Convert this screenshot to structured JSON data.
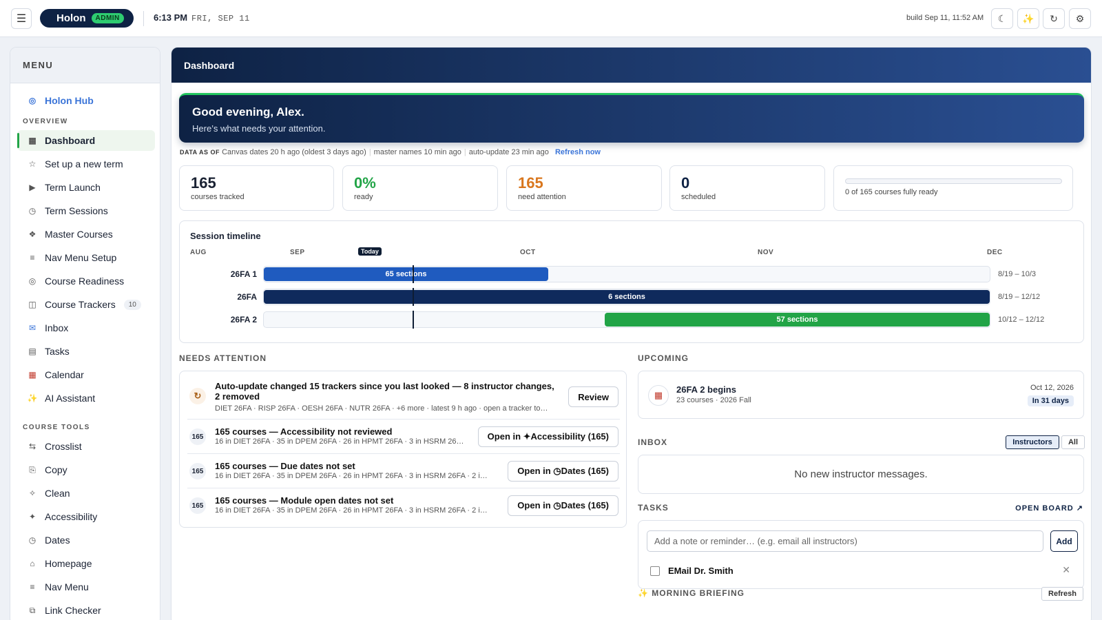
{
  "topbar": {
    "menu_icon": "hamburger-icon",
    "brand": "Holon",
    "brand_badge": "ADMIN",
    "time": "6:13 PM",
    "date": "FRI, SEP 11",
    "build": "build Sep 11, 11:52 AM",
    "buttons": [
      "moon-icon",
      "sparkles-icon",
      "refresh-icon",
      "gear-icon"
    ]
  },
  "sidebar": {
    "title": "MENU",
    "hub": "Holon Hub",
    "overview_label": "OVERVIEW",
    "overview": [
      {
        "label": "Dashboard",
        "icon": "grid-icon"
      },
      {
        "label": "Set up a new term",
        "icon": "star-icon"
      },
      {
        "label": "Term Launch",
        "icon": "play-icon"
      },
      {
        "label": "Term Sessions",
        "icon": "clock-icon"
      },
      {
        "label": "Master Courses",
        "icon": "diamond-icon"
      },
      {
        "label": "Nav Menu Setup",
        "icon": "list-icon"
      },
      {
        "label": "Course Readiness",
        "icon": "target-icon"
      },
      {
        "label": "Course Trackers",
        "icon": "columns-icon",
        "count": "10"
      },
      {
        "label": "Inbox",
        "icon": "mailbox-icon"
      },
      {
        "label": "Tasks",
        "icon": "checklist-icon"
      },
      {
        "label": "Calendar",
        "icon": "calendar-icon"
      },
      {
        "label": "AI Assistant",
        "icon": "sparkles-icon"
      }
    ],
    "tools_label": "COURSE TOOLS",
    "tools": [
      {
        "label": "Crosslist",
        "icon": "arrows-icon"
      },
      {
        "label": "Copy",
        "icon": "copy-icon"
      },
      {
        "label": "Clean",
        "icon": "sparkle-icon"
      },
      {
        "label": "Accessibility",
        "icon": "star4-icon"
      },
      {
        "label": "Dates",
        "icon": "clock-icon"
      },
      {
        "label": "Homepage",
        "icon": "home-icon"
      },
      {
        "label": "Nav Menu",
        "icon": "list-icon"
      },
      {
        "label": "Link Checker",
        "icon": "link-icon"
      }
    ]
  },
  "main": {
    "title": "Dashboard",
    "greeting": "Good evening, Alex.",
    "greeting_sub": "Here’s what needs your attention.",
    "data_as_of": {
      "label": "DATA AS OF",
      "canvas": "Canvas dates 20 h ago (oldest 3 days ago)",
      "master": "master names 10 min ago",
      "auto": "auto-update 23 min ago",
      "refresh": "Refresh now"
    },
    "stats": [
      {
        "value": "165",
        "label": "courses tracked",
        "color": "#1a2233"
      },
      {
        "value": "0%",
        "label": "ready",
        "color": "#22a447"
      },
      {
        "value": "165",
        "label": "need attention",
        "color": "#d9771e"
      },
      {
        "value": "0",
        "label": "scheduled",
        "color": "#0e2244"
      }
    ],
    "readiness": {
      "label": "0 of 165 courses fully ready",
      "fraction": 0
    }
  },
  "chart_data": {
    "type": "gantt",
    "title": "Session timeline",
    "months": [
      "AUG",
      "SEP",
      "OCT",
      "NOV",
      "DEC"
    ],
    "today": "Today",
    "today_date": "Sep 11",
    "rows": [
      {
        "label": "26FA 1",
        "bar": "65 sections",
        "start": "8/19",
        "end": "10/3",
        "range": "8/19 – 10/3",
        "color": "#1f5bbf"
      },
      {
        "label": "26FA",
        "bar": "6 sections",
        "start": "8/19",
        "end": "12/12",
        "range": "8/19 – 12/12",
        "color": "#0f2a5c"
      },
      {
        "label": "26FA 2",
        "bar": "57 sections",
        "start": "10/12",
        "end": "12/12",
        "range": "10/12 – 12/12",
        "color": "#22a447"
      }
    ]
  },
  "needs_attention": {
    "title": "NEEDS ATTENTION",
    "items": [
      {
        "icon": "refresh-icon",
        "badge": "↻",
        "title": "Auto-update changed 15 trackers since you last looked — 8 instructor changes, 2 removed",
        "sub": "DIET 26FA · RISP 26FA · OESH 26FA · NUTR 26FA · +6 more · latest 9 h ago · open a tracker to…",
        "button": "Review"
      },
      {
        "badge": "165",
        "title": "165 courses — Accessibility not reviewed",
        "sub": "16 in DIET 26FA · 35 in DPEM 26FA · 26 in HPMT 26FA · 3 in HSRM 26…",
        "button": "Open in ✦Accessibility (165)"
      },
      {
        "badge": "165",
        "title": "165 courses — Due dates not set",
        "sub": "16 in DIET 26FA · 35 in DPEM 26FA · 26 in HPMT 26FA · 3 in HSRM 26FA · 2 i…",
        "button": "Open in ◷Dates (165)"
      },
      {
        "badge": "165",
        "title": "165 courses — Module open dates not set",
        "sub": "16 in DIET 26FA · 35 in DPEM 26FA · 26 in HPMT 26FA · 3 in HSRM 26FA · 2 i…",
        "button": "Open in ◷Dates (165)"
      }
    ]
  },
  "upcoming": {
    "title": "UPCOMING",
    "icon": "calendar-icon",
    "event": "26FA 2 begins",
    "sub": "23 courses · 2026 Fall",
    "date": "Oct 12, 2026",
    "badge": "In 31 days"
  },
  "inbox": {
    "title": "INBOX",
    "tabs": [
      "Instructors",
      "All"
    ],
    "empty": "No new instructor messages."
  },
  "tasks": {
    "title": "TASKS",
    "open_board": "OPEN BOARD ↗",
    "placeholder": "Add a note or reminder… (e.g. email all instructors)",
    "add": "Add",
    "items": [
      {
        "text": "EMail Dr. Smith",
        "done": false
      }
    ]
  },
  "briefing": {
    "title": "✨ MORNING BRIEFING",
    "refresh": "Refresh"
  }
}
